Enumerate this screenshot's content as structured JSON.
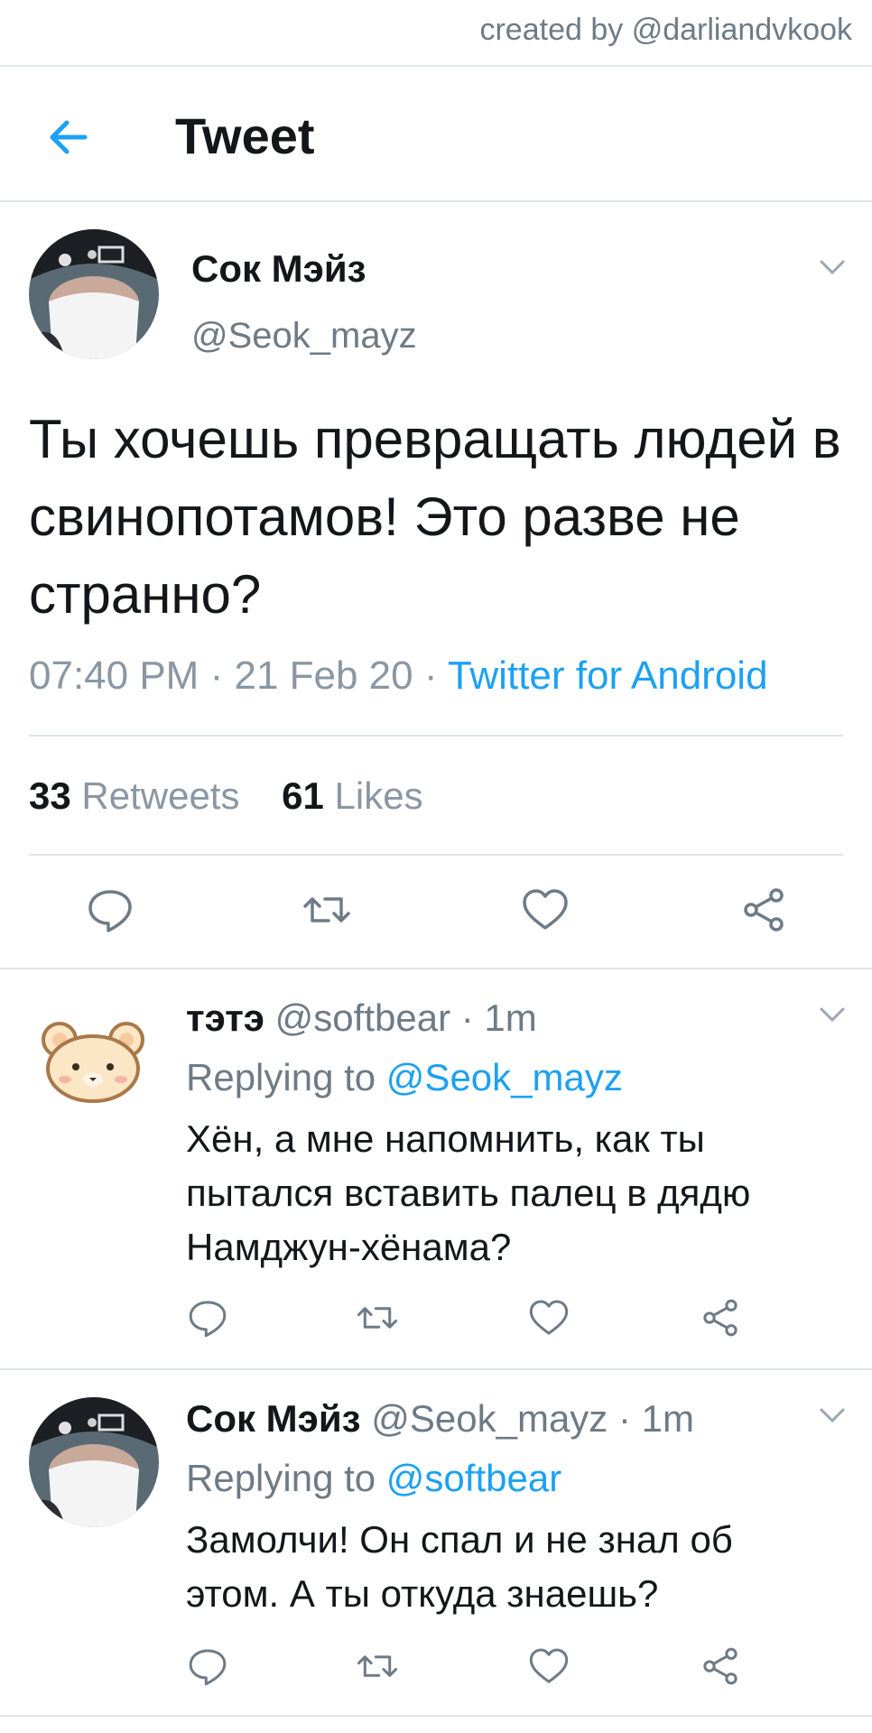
{
  "credit": "created by @darliandvkook",
  "header": {
    "title": "Tweet",
    "back_icon": "arrow-left-icon"
  },
  "colors": {
    "accent": "#1da1f2",
    "secondary_text": "#6e7b86",
    "divider": "#dfe5ea"
  },
  "main_tweet": {
    "name": "Сок Мэйз",
    "handle": "@Seok_mayz",
    "text": "Ты хочешь превращать людей в свинопотамов! Это разве не странно?",
    "time": "07:40 PM",
    "sep1": "·",
    "date": "21 Feb 20",
    "sep2": "·",
    "source": "Twitter for Android",
    "retweets_count": "33",
    "retweets_label": "Retweets",
    "likes_count": "61",
    "likes_label": "Likes"
  },
  "replies": [
    {
      "name": "тэтэ",
      "handle": "@softbear",
      "sep": "·",
      "time": "1m",
      "replying_prefix": "Replying to",
      "replying_to": "@Seok_mayz",
      "text": "Хён, а мне напомнить, как ты пытался вставить палец в дядю Намджун-хёнама?"
    },
    {
      "name": "Сок Мэйз",
      "handle": "@Seok_mayz",
      "sep": "·",
      "time": "1m",
      "replying_prefix": "Replying to",
      "replying_to": "@softbear",
      "text": "Замолчи! Он спал и не знал об этом. А ты откуда знаешь?"
    }
  ],
  "action_icons": [
    "reply-icon",
    "retweet-icon",
    "like-icon",
    "share-icon"
  ]
}
